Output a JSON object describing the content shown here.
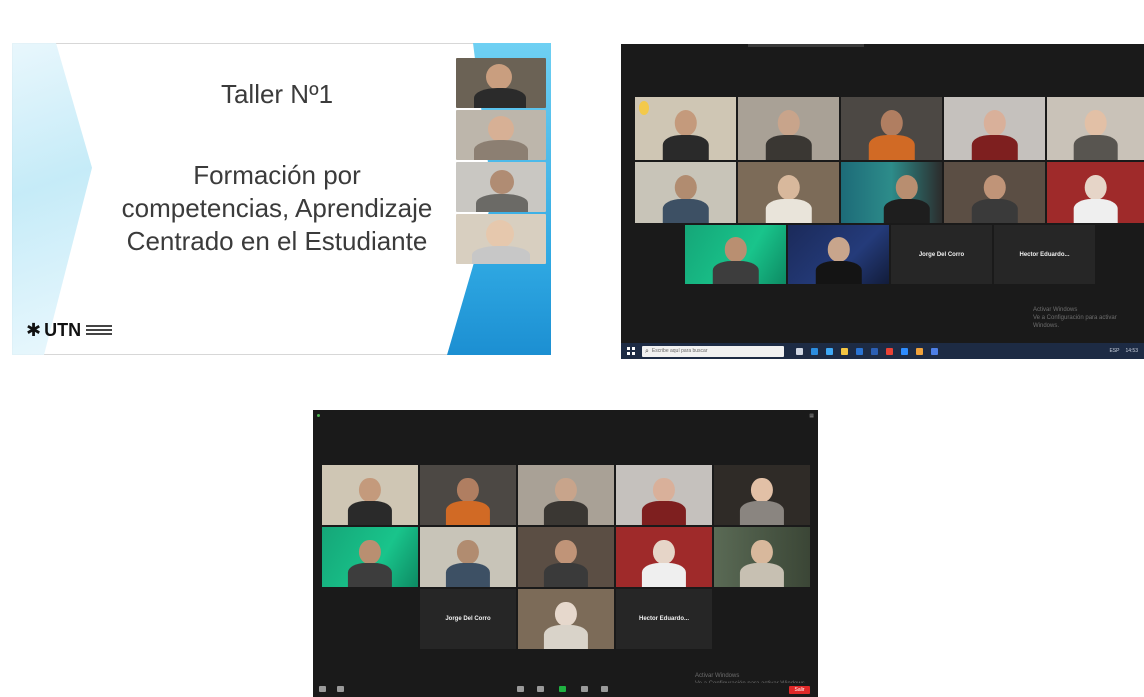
{
  "slide": {
    "title": "Taller Nº1",
    "subtitle_lines": [
      "Formación por",
      "competencias, Aprendizaje",
      "Centrado en el Estudiante"
    ],
    "logo_text": "UTN"
  },
  "zoom_gallery_1": {
    "participants_named": [
      {
        "label": "Jorge Del Corro"
      },
      {
        "label": "Hector Eduardo..."
      }
    ],
    "watermark": {
      "line1": "Activar Windows",
      "line2": "Ve a Configuración para activar Windows."
    },
    "taskbar": {
      "search_placeholder": "Escribe aquí para buscar",
      "tray_time": "14:53",
      "tray_lang": "ESP"
    }
  },
  "zoom_gallery_2": {
    "participants_named": [
      {
        "label": "Jorge Del Corro"
      },
      {
        "label": "Hector Eduardo..."
      }
    ],
    "watermark": {
      "line1": "Activar Windows",
      "line2": "Ve a Configuración para activar Windows."
    },
    "toolbar": {
      "end_label": "Salir"
    }
  },
  "colors": {
    "zoom_bg": "#1a1a1a",
    "active_speaker": "#d5d04a",
    "slide_accent": "#2fa8e2",
    "end_button": "#e02828"
  }
}
